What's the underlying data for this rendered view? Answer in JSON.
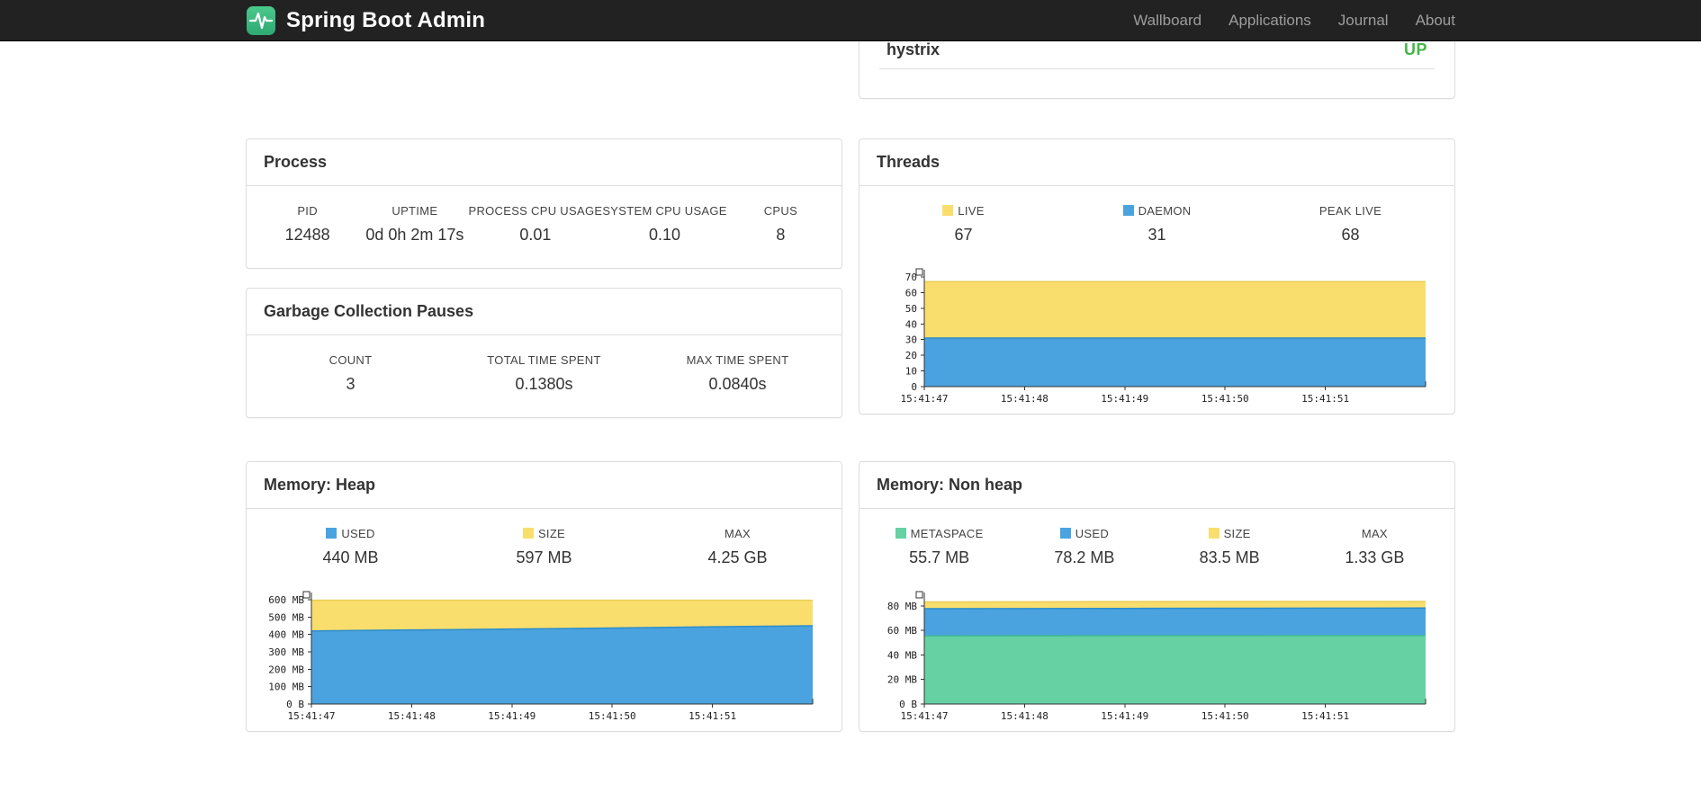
{
  "navbar": {
    "brand": "Spring Boot Admin",
    "items": [
      {
        "label": "Wallboard"
      },
      {
        "label": "Applications"
      },
      {
        "label": "Journal"
      },
      {
        "label": "About"
      }
    ]
  },
  "colors": {
    "up_green": "#44b549",
    "live_yellow": "#F9DE6D",
    "daemon_blue": "#4AA3DF",
    "metaspace_green": "#66D1A3"
  },
  "application_panel": {
    "rows": [
      {
        "name": "hystrix",
        "status": "UP"
      }
    ]
  },
  "panels": {
    "process": {
      "title": "Process",
      "stats": [
        {
          "label": "PID",
          "value": "12488"
        },
        {
          "label": "UPTIME",
          "value": "0d 0h 2m 17s"
        },
        {
          "label": "PROCESS CPU USAGE",
          "value": "0.01"
        },
        {
          "label": "SYSTEM CPU USAGE",
          "value": "0.10"
        },
        {
          "label": "CPUS",
          "value": "8"
        }
      ]
    },
    "gc": {
      "title": "Garbage Collection Pauses",
      "stats": [
        {
          "label": "COUNT",
          "value": "3"
        },
        {
          "label": "TOTAL TIME SPENT",
          "value": "0.1380s"
        },
        {
          "label": "MAX TIME SPENT",
          "value": "0.0840s"
        }
      ]
    },
    "threads": {
      "title": "Threads",
      "stats": [
        {
          "label": "LIVE",
          "value": "67",
          "color": "#F9DE6D"
        },
        {
          "label": "DAEMON",
          "value": "31",
          "color": "#4AA3DF"
        },
        {
          "label": "PEAK LIVE",
          "value": "68"
        }
      ]
    },
    "heap": {
      "title": "Memory: Heap",
      "stats": [
        {
          "label": "USED",
          "value": "440 MB",
          "color": "#4AA3DF"
        },
        {
          "label": "SIZE",
          "value": "597 MB",
          "color": "#F9DE6D"
        },
        {
          "label": "MAX",
          "value": "4.25 GB"
        }
      ]
    },
    "nonheap": {
      "title": "Memory: Non heap",
      "stats": [
        {
          "label": "METASPACE",
          "value": "55.7 MB",
          "color": "#66D1A3"
        },
        {
          "label": "USED",
          "value": "78.2 MB",
          "color": "#4AA3DF"
        },
        {
          "label": "SIZE",
          "value": "83.5 MB",
          "color": "#F9DE6D"
        },
        {
          "label": "MAX",
          "value": "1.33 GB"
        }
      ]
    }
  },
  "chart_data": [
    {
      "id": "threads",
      "type": "area",
      "title": "Threads",
      "x": [
        "15:41:47",
        "15:41:48",
        "15:41:49",
        "15:41:50",
        "15:41:51"
      ],
      "ylim": [
        0,
        70
      ],
      "yticks": [
        {
          "v": 0,
          "label": "0"
        },
        {
          "v": 10,
          "label": "10"
        },
        {
          "v": 20,
          "label": "20"
        },
        {
          "v": 30,
          "label": "30"
        },
        {
          "v": 40,
          "label": "40"
        },
        {
          "v": 50,
          "label": "50"
        },
        {
          "v": 60,
          "label": "60"
        },
        {
          "v": 70,
          "label": "70"
        }
      ],
      "series": [
        {
          "name": "LIVE",
          "color": "#F9DE6D",
          "stroke": "#E9CC55",
          "values": [
            67,
            67,
            67,
            67,
            67,
            67
          ]
        },
        {
          "name": "DAEMON",
          "color": "#4AA3DF",
          "stroke": "#2B8CCB",
          "values": [
            31,
            31,
            31,
            31,
            31,
            31
          ]
        }
      ]
    },
    {
      "id": "heap",
      "type": "area",
      "title": "Memory: Heap",
      "x": [
        "15:41:47",
        "15:41:48",
        "15:41:49",
        "15:41:50",
        "15:41:51"
      ],
      "ylim": [
        0,
        600
      ],
      "yticks": [
        {
          "v": 0,
          "label": "0 B"
        },
        {
          "v": 100,
          "label": "100 MB"
        },
        {
          "v": 200,
          "label": "200 MB"
        },
        {
          "v": 300,
          "label": "300 MB"
        },
        {
          "v": 400,
          "label": "400 MB"
        },
        {
          "v": 500,
          "label": "500 MB"
        },
        {
          "v": 600,
          "label": "600 MB"
        }
      ],
      "series": [
        {
          "name": "SIZE",
          "color": "#F9DE6D",
          "stroke": "#E9CC55",
          "values": [
            597,
            597,
            597,
            597,
            597,
            597
          ]
        },
        {
          "name": "USED",
          "color": "#4AA3DF",
          "stroke": "#2B8CCB",
          "values": [
            420,
            426,
            431,
            437,
            444,
            450
          ]
        }
      ]
    },
    {
      "id": "nonheap",
      "type": "area",
      "title": "Memory: Non heap",
      "x": [
        "15:41:47",
        "15:41:48",
        "15:41:49",
        "15:41:50",
        "15:41:51"
      ],
      "ylim": [
        0,
        85
      ],
      "yticks": [
        {
          "v": 0,
          "label": "0 B"
        },
        {
          "v": 20,
          "label": "20 MB"
        },
        {
          "v": 40,
          "label": "40 MB"
        },
        {
          "v": 60,
          "label": "60 MB"
        },
        {
          "v": 80,
          "label": "80 MB"
        }
      ],
      "series": [
        {
          "name": "SIZE",
          "color": "#F9DE6D",
          "stroke": "#E9CC55",
          "values": [
            83.2,
            83.3,
            83.4,
            83.5,
            83.5,
            83.5
          ]
        },
        {
          "name": "USED",
          "color": "#4AA3DF",
          "stroke": "#2B8CCB",
          "values": [
            77.7,
            77.8,
            77.9,
            78.0,
            78.1,
            78.2
          ]
        },
        {
          "name": "METASPACE",
          "color": "#66D1A3",
          "stroke": "#44BD8C",
          "values": [
            55.4,
            55.5,
            55.6,
            55.6,
            55.7,
            55.7
          ]
        }
      ]
    }
  ]
}
